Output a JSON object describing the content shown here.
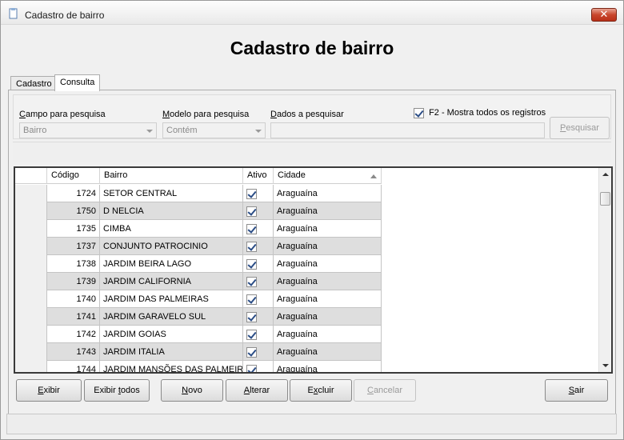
{
  "window": {
    "title": "Cadastro de bairro",
    "close_glyph": "✕"
  },
  "heading": "Cadastro de bairro",
  "tabs": [
    {
      "label": "Cadastro",
      "active": false
    },
    {
      "label": "Consulta",
      "active": true
    }
  ],
  "filters": {
    "campo_label": "Campo para pesquisa",
    "campo_value": "Bairro",
    "modelo_label": "Modelo para pesquisa",
    "modelo_value": "Contém",
    "dados_label": "Dados a pesquisar",
    "dados_value": "",
    "show_all_label": "F2 - Mostra todos os registros",
    "show_all_checked": true,
    "search_button": "Pesquisar"
  },
  "grid": {
    "columns": [
      "Código",
      "Bairro",
      "Ativo",
      "Cidade"
    ],
    "rows": [
      {
        "codigo": "1724",
        "bairro": "SETOR CENTRAL",
        "ativo": true,
        "cidade": "Araguaína"
      },
      {
        "codigo": "1750",
        "bairro": "D NELCIA",
        "ativo": true,
        "cidade": "Araguaína"
      },
      {
        "codigo": "1735",
        "bairro": "CIMBA",
        "ativo": true,
        "cidade": "Araguaína"
      },
      {
        "codigo": "1737",
        "bairro": "CONJUNTO PATROCINIO",
        "ativo": true,
        "cidade": "Araguaína"
      },
      {
        "codigo": "1738",
        "bairro": "JARDIM BEIRA LAGO",
        "ativo": true,
        "cidade": "Araguaína"
      },
      {
        "codigo": "1739",
        "bairro": "JARDIM CALIFORNIA",
        "ativo": true,
        "cidade": "Araguaína"
      },
      {
        "codigo": "1740",
        "bairro": "JARDIM DAS PALMEIRAS",
        "ativo": true,
        "cidade": "Araguaína"
      },
      {
        "codigo": "1741",
        "bairro": "JARDIM GARAVELO SUL",
        "ativo": true,
        "cidade": "Araguaína"
      },
      {
        "codigo": "1742",
        "bairro": "JARDIM GOIAS",
        "ativo": true,
        "cidade": "Araguaína"
      },
      {
        "codigo": "1743",
        "bairro": "JARDIM ITALIA",
        "ativo": true,
        "cidade": "Araguaína"
      },
      {
        "codigo": "1744",
        "bairro": "JARDIM MANSÕES DAS PALMEIRAS",
        "ativo": true,
        "cidade": "Araguaína"
      }
    ]
  },
  "buttons": {
    "exibir": "Exibir",
    "exibir_todos": "Exibir todos",
    "novo": "Novo",
    "alterar": "Alterar",
    "excluir": "Excluir",
    "cancelar": "Cancelar",
    "sair": "Sair"
  },
  "colors": {
    "row_alt": "#dedede",
    "close_button": "#c9462c",
    "checkbox_mark": "#2b4d86"
  },
  "icons": [
    "app-icon",
    "close-icon",
    "dropdown-arrow-icon",
    "sort-ascending-icon",
    "scroll-up-icon",
    "scroll-down-icon"
  ]
}
